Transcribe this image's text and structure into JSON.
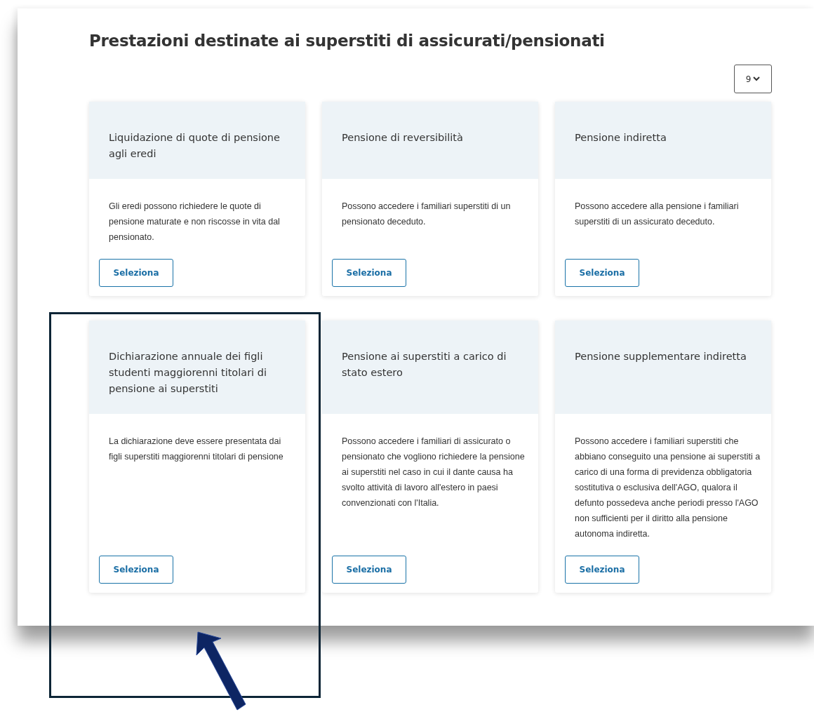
{
  "page": {
    "title": "Prestazioni destinate ai superstiti di assicurati/pensionati",
    "per_page": "9"
  },
  "cards": [
    {
      "title": "Liquidazione di quote di pensione agli eredi",
      "description": "Gli eredi possono richiedere le quote di pensione maturate e non riscosse in vita dal pensionato.",
      "button": "Seleziona"
    },
    {
      "title": "Pensione di reversibilità",
      "description": "Possono accedere i familiari superstiti di un pensionato deceduto.",
      "button": "Seleziona"
    },
    {
      "title": "Pensione indiretta",
      "description": "Possono accedere alla pensione i familiari superstiti di un assicurato deceduto.",
      "button": "Seleziona"
    },
    {
      "title": "Dichiarazione annuale dei figli studenti maggiorenni titolari di pensione ai superstiti",
      "description": "La dichiarazione deve essere presentata dai figli superstiti maggiorenni titolari di pensione",
      "button": "Seleziona"
    },
    {
      "title": "Pensione ai superstiti a carico di stato estero",
      "description": "Possono accedere i familiari di assicurato o pensionato che vogliono richiedere la pensione ai superstiti nel caso in cui il dante causa ha svolto attività di lavoro all'estero in paesi convenzionati con l'Italia.",
      "button": "Seleziona"
    },
    {
      "title": "Pensione supplementare indiretta",
      "description": "Possono accedere i familiari superstiti che abbiano conseguito una pensione ai superstiti a carico di una forma di previdenza obbligatoria sostitutiva o esclusiva dell'AGO, qualora il defunto possedeva anche periodi presso l'AGO non sufficienti per il diritto alla pensione autonoma indiretta.",
      "button": "Seleziona"
    }
  ],
  "annotations": [
    {
      "kind": "frame"
    },
    {
      "kind": "arrow"
    }
  ]
}
